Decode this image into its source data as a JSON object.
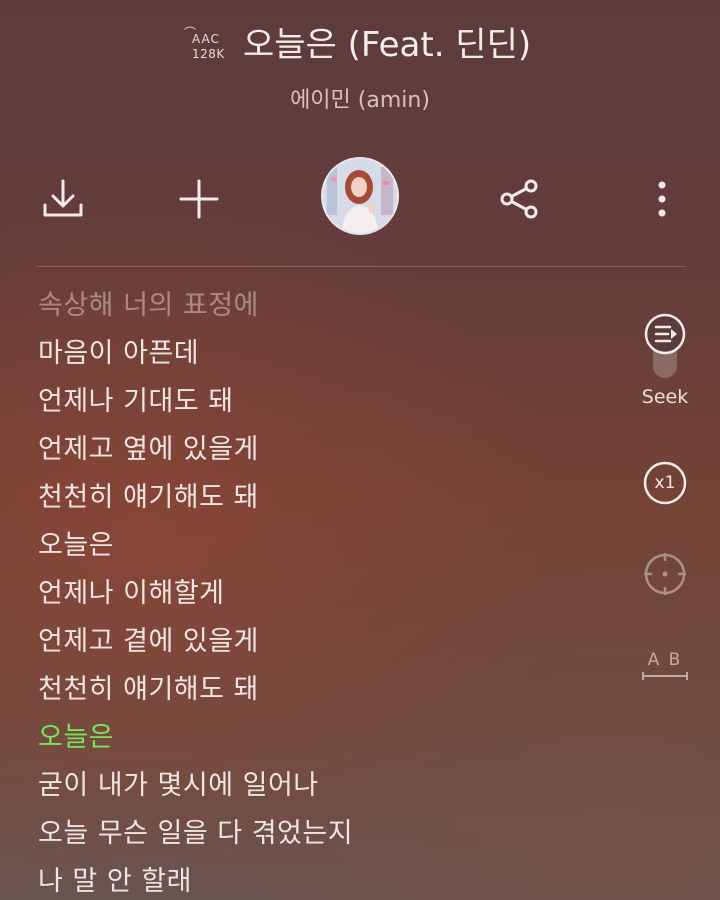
{
  "header": {
    "codec": "AAC",
    "bitrate": "128K",
    "title": "오늘은 (Feat. 딘딘)",
    "artist": "에이민 (amin)"
  },
  "toolbar": {
    "download_icon": "download-icon",
    "add_icon": "plus-icon",
    "share_icon": "share-icon",
    "more_icon": "more-vertical-icon"
  },
  "lyrics": {
    "lines": [
      "속상해 너의 표정에",
      "마음이 아픈데",
      "언제나 기대도 돼",
      "언제고 옆에 있을게",
      "천천히 얘기해도 돼",
      "오늘은",
      "언제나 이해할게",
      "언제고 곁에 있을게",
      "천천히 얘기해도 돼",
      "오늘은",
      "굳이 내가 몇시에 일어나",
      "오늘 무슨 일을 다 겪었는지",
      "나 말 안 할래"
    ],
    "current_index": 9
  },
  "side_controls": {
    "seek_label": "Seek",
    "speed_label": "x1",
    "ab_label": "A B"
  },
  "colors": {
    "highlight": "#79e45a",
    "text": "#efe4e2"
  }
}
